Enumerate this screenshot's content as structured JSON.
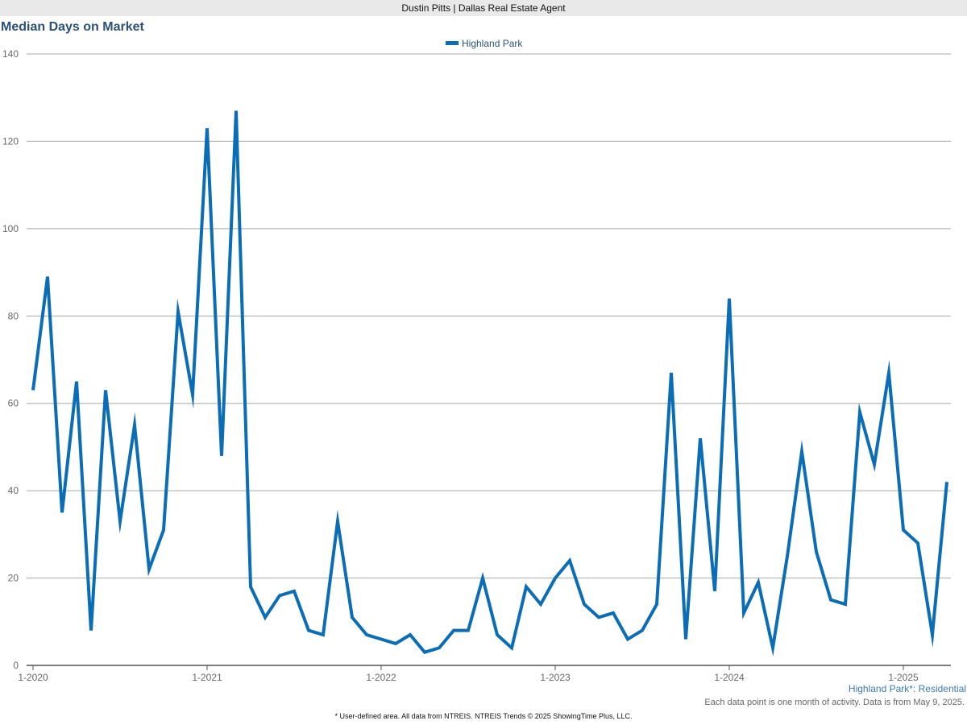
{
  "header": {
    "text": "Dustin Pitts | Dallas Real Estate Agent"
  },
  "chart_data": {
    "type": "line",
    "title": "Median Days on Market",
    "xlabel": "",
    "ylabel": "",
    "ylim": [
      0,
      140
    ],
    "yticks": [
      0,
      20,
      40,
      60,
      80,
      100,
      120,
      140
    ],
    "xtick_labels": [
      "1-2020",
      "1-2021",
      "1-2022",
      "1-2023",
      "1-2024",
      "1-2025"
    ],
    "grid": true,
    "legend_position": "top-center",
    "series": [
      {
        "name": "Highland Park",
        "color": "#0b6db5",
        "x": [
          "2020-01",
          "2020-02",
          "2020-03",
          "2020-04",
          "2020-05",
          "2020-06",
          "2020-07",
          "2020-08",
          "2020-09",
          "2020-10",
          "2020-11",
          "2020-12",
          "2021-01",
          "2021-02",
          "2021-03",
          "2021-04",
          "2021-05",
          "2021-06",
          "2021-07",
          "2021-08",
          "2021-09",
          "2021-10",
          "2021-11",
          "2021-12",
          "2022-01",
          "2022-02",
          "2022-03",
          "2022-04",
          "2022-05",
          "2022-06",
          "2022-07",
          "2022-08",
          "2022-09",
          "2022-10",
          "2022-11",
          "2022-12",
          "2023-01",
          "2023-02",
          "2023-03",
          "2023-04",
          "2023-05",
          "2023-06",
          "2023-07",
          "2023-08",
          "2023-09",
          "2023-10",
          "2023-11",
          "2023-12",
          "2024-01",
          "2024-02",
          "2024-03",
          "2024-04",
          "2024-05",
          "2024-06",
          "2024-07",
          "2024-08",
          "2024-09",
          "2024-10",
          "2024-11",
          "2024-12",
          "2025-01",
          "2025-02",
          "2025-03",
          "2025-04"
        ],
        "values": [
          63,
          89,
          35,
          65,
          8,
          63,
          33,
          55,
          22,
          31,
          81,
          62,
          123,
          48,
          127,
          18,
          11,
          16,
          17,
          8,
          7,
          33,
          11,
          7,
          6,
          5,
          7,
          3,
          4,
          8,
          8,
          20,
          7,
          4,
          18,
          14,
          20,
          24,
          14,
          11,
          12,
          6,
          8,
          14,
          67,
          6,
          52,
          17,
          84,
          12,
          19,
          4,
          25,
          49,
          26,
          15,
          14,
          58,
          46,
          67,
          31,
          28,
          7,
          42
        ]
      }
    ],
    "area_label": "Highland Park*: Residential",
    "note": "Each data point is one month of activity. Data is from May 9, 2025.",
    "source": "* User-defined area. All data from NTREIS. NTREIS Trends © 2025 ShowingTime Plus, LLC."
  }
}
